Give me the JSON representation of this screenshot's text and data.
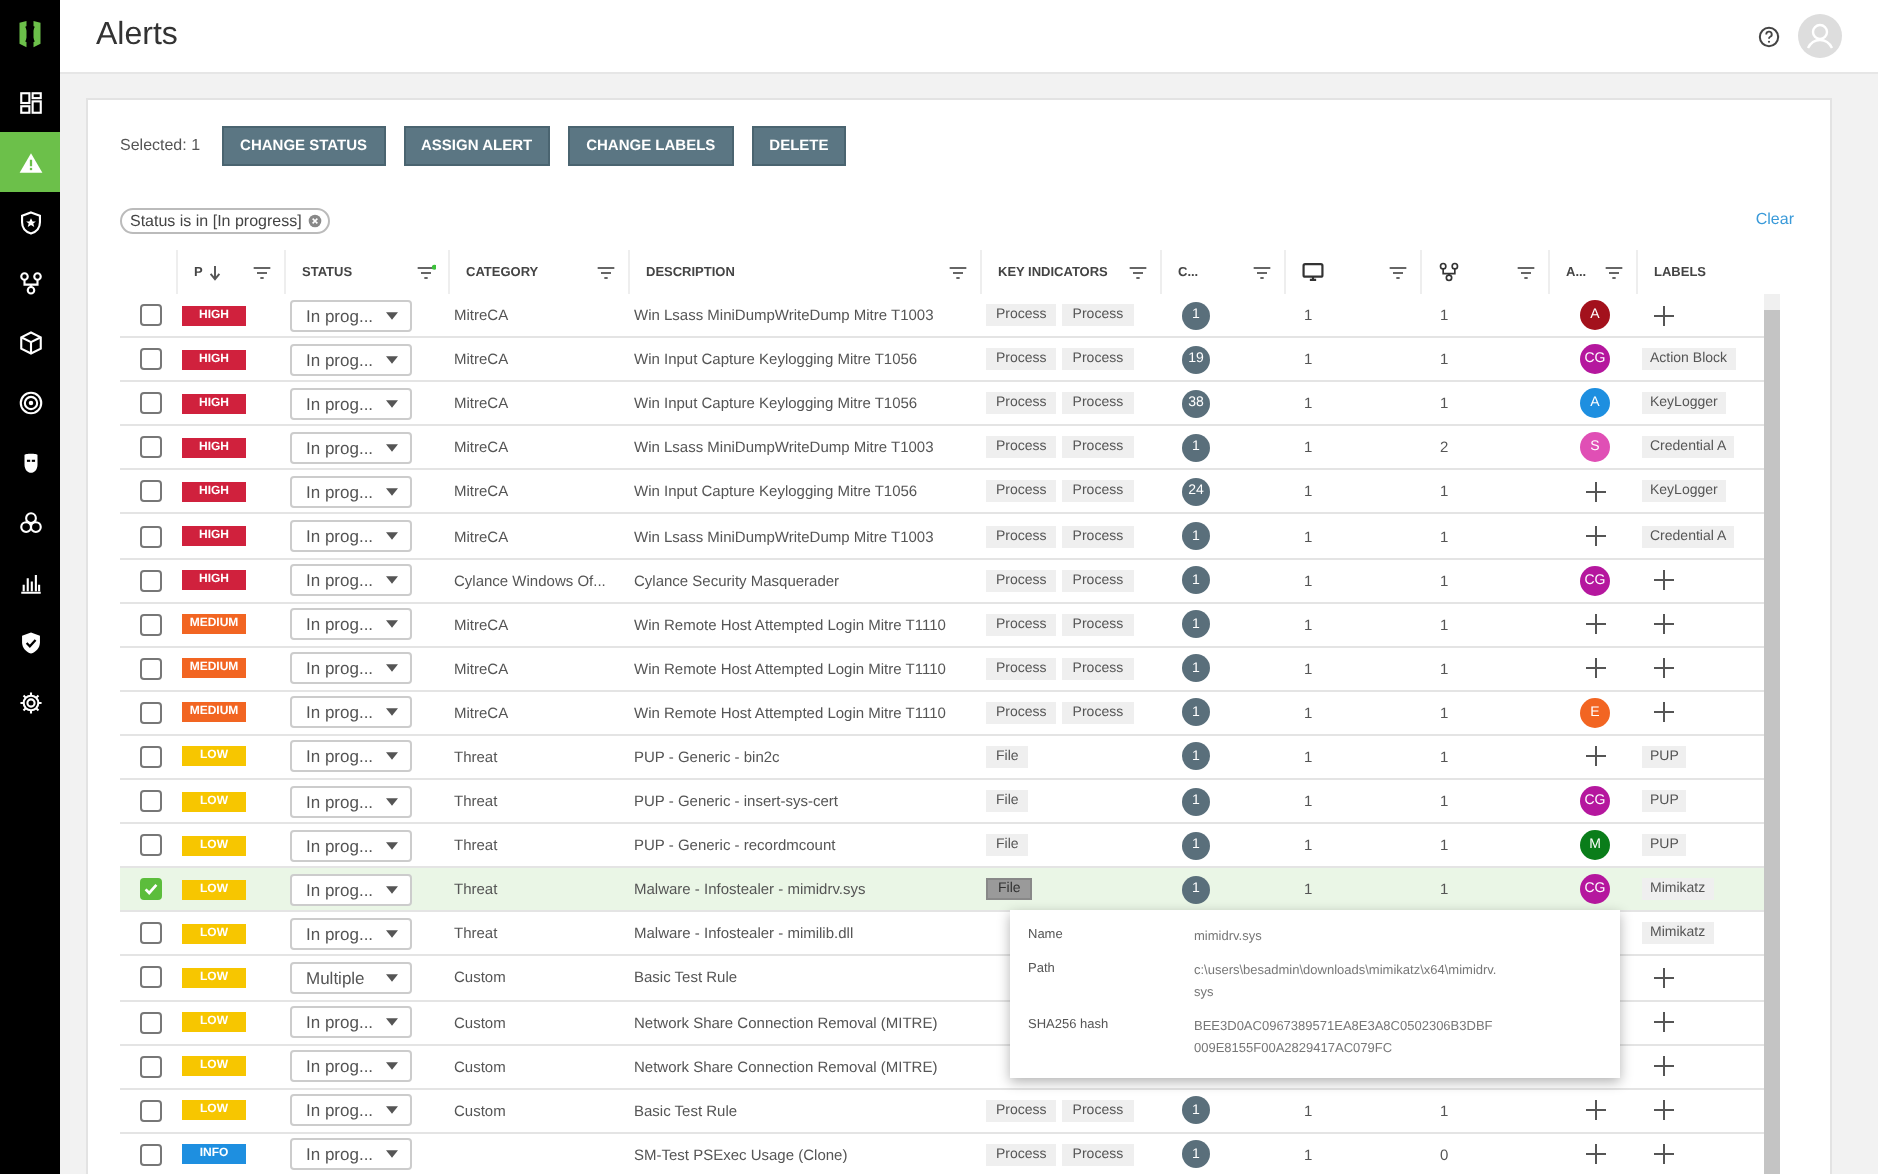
{
  "sidebar": {
    "items": [
      {
        "selected": false
      },
      {
        "selected": true
      },
      {
        "selected": false
      },
      {
        "selected": false
      },
      {
        "selected": false
      },
      {
        "selected": false
      },
      {
        "selected": false
      },
      {
        "selected": false
      },
      {
        "selected": false
      },
      {
        "selected": false
      },
      {
        "selected": false
      }
    ]
  },
  "header": {
    "title": "Alerts"
  },
  "toolbar": {
    "selected_count": "Selected: 1",
    "buttons": [
      "CHANGE STATUS",
      "ASSIGN ALERT",
      "CHANGE LABELS",
      "DELETE"
    ]
  },
  "filters": {
    "chips": [
      "Status is in [In progress]"
    ],
    "clear": "Clear"
  },
  "table": {
    "columns": [
      {
        "kind": "text",
        "label": "P",
        "sorted": true,
        "filter_active": false
      },
      {
        "kind": "text",
        "label": "STATUS",
        "filter_active": true
      },
      {
        "kind": "text",
        "label": "CATEGORY",
        "filter_active": false
      },
      {
        "kind": "text",
        "label": "DESCRIPTION",
        "filter_active": false
      },
      {
        "kind": "text",
        "label": "KEY INDICATORS",
        "filter_active": false
      },
      {
        "kind": "text",
        "label": "C...",
        "filter_active": false
      },
      {
        "kind": "monitor",
        "filter_active": false
      },
      {
        "kind": "network",
        "filter_active": false
      },
      {
        "kind": "text",
        "label": "A...",
        "filter_active": false
      },
      {
        "kind": "text",
        "label": "LABELS"
      }
    ],
    "rows": [
      {
        "checked": false,
        "priority": {
          "text": "HIGH",
          "color": "#d0213d"
        },
        "status": "In prog...",
        "category": "MitreCA",
        "description": "Win Lsass MiniDumpWriteDump Mitre T1003",
        "indicators": [
          {
            "text": "Process",
            "open": false
          },
          {
            "text": "Process",
            "open": false
          }
        ],
        "count": "1",
        "column_7": "1",
        "column_8": "1",
        "assignee": {
          "kind": "avatar",
          "initials": "A",
          "color": "#a3111c"
        },
        "label": {
          "kind": "add"
        }
      },
      {
        "checked": false,
        "priority": {
          "text": "HIGH",
          "color": "#d0213d"
        },
        "status": "In prog...",
        "category": "MitreCA",
        "description": "Win Input Capture Keylogging Mitre T1056",
        "indicators": [
          {
            "text": "Process",
            "open": false
          },
          {
            "text": "Process",
            "open": false
          }
        ],
        "count": "19",
        "column_7": "1",
        "column_8": "1",
        "assignee": {
          "kind": "avatar",
          "initials": "CG",
          "color": "#b5179e"
        },
        "label": {
          "kind": "tag",
          "text": "Action Block"
        }
      },
      {
        "checked": false,
        "priority": {
          "text": "HIGH",
          "color": "#d0213d"
        },
        "status": "In prog...",
        "category": "MitreCA",
        "description": "Win Input Capture Keylogging Mitre T1056",
        "indicators": [
          {
            "text": "Process",
            "open": false
          },
          {
            "text": "Process",
            "open": false
          }
        ],
        "count": "38",
        "column_7": "1",
        "column_8": "1",
        "assignee": {
          "kind": "avatar",
          "initials": "A",
          "color": "#1e8fe0"
        },
        "label": {
          "kind": "tag",
          "text": "KeyLogger"
        }
      },
      {
        "checked": false,
        "priority": {
          "text": "HIGH",
          "color": "#d0213d"
        },
        "status": "In prog...",
        "category": "MitreCA",
        "description": "Win Lsass MiniDumpWriteDump Mitre T1003",
        "indicators": [
          {
            "text": "Process",
            "open": false
          },
          {
            "text": "Process",
            "open": false
          }
        ],
        "count": "1",
        "column_7": "1",
        "column_8": "2",
        "assignee": {
          "kind": "avatar",
          "initials": "S",
          "color": "#e04fb5"
        },
        "label": {
          "kind": "tag",
          "text": "Credential A"
        }
      },
      {
        "checked": false,
        "priority": {
          "text": "HIGH",
          "color": "#d0213d"
        },
        "status": "In prog...",
        "category": "MitreCA",
        "description": "Win Input Capture Keylogging Mitre T1056",
        "indicators": [
          {
            "text": "Process",
            "open": false
          },
          {
            "text": "Process",
            "open": false
          }
        ],
        "count": "24",
        "column_7": "1",
        "column_8": "1",
        "assignee": {
          "kind": "add"
        },
        "label": {
          "kind": "tag",
          "text": "KeyLogger"
        }
      },
      {
        "checked": false,
        "priority": {
          "text": "HIGH",
          "color": "#d0213d"
        },
        "status": "In prog...",
        "category": "MitreCA",
        "description": "Win Lsass MiniDumpWriteDump Mitre T1003",
        "indicators": [
          {
            "text": "Process",
            "open": false
          },
          {
            "text": "Process",
            "open": false
          }
        ],
        "count": "1",
        "column_7": "1",
        "column_8": "1",
        "assignee": {
          "kind": "add"
        },
        "label": {
          "kind": "tag",
          "text": "Credential A"
        }
      },
      {
        "checked": false,
        "priority": {
          "text": "HIGH",
          "color": "#d0213d"
        },
        "status": "In prog...",
        "category": "Cylance Windows Of...",
        "description": "Cylance Security Masquerader",
        "indicators": [
          {
            "text": "Process",
            "open": false
          },
          {
            "text": "Process",
            "open": false
          }
        ],
        "count": "1",
        "column_7": "1",
        "column_8": "1",
        "assignee": {
          "kind": "avatar",
          "initials": "CG",
          "color": "#b5179e"
        },
        "label": {
          "kind": "add"
        }
      },
      {
        "checked": false,
        "priority": {
          "text": "MEDIUM",
          "color": "#f26522"
        },
        "status": "In prog...",
        "category": "MitreCA",
        "description": "Win Remote Host Attempted Login Mitre T1110",
        "indicators": [
          {
            "text": "Process",
            "open": false
          },
          {
            "text": "Process",
            "open": false
          }
        ],
        "count": "1",
        "column_7": "1",
        "column_8": "1",
        "assignee": {
          "kind": "add"
        },
        "label": {
          "kind": "add"
        }
      },
      {
        "checked": false,
        "priority": {
          "text": "MEDIUM",
          "color": "#f26522"
        },
        "status": "In prog...",
        "category": "MitreCA",
        "description": "Win Remote Host Attempted Login Mitre T1110",
        "indicators": [
          {
            "text": "Process",
            "open": false
          },
          {
            "text": "Process",
            "open": false
          }
        ],
        "count": "1",
        "column_7": "1",
        "column_8": "1",
        "assignee": {
          "kind": "add"
        },
        "label": {
          "kind": "add"
        }
      },
      {
        "checked": false,
        "priority": {
          "text": "MEDIUM",
          "color": "#f26522"
        },
        "status": "In prog...",
        "category": "MitreCA",
        "description": "Win Remote Host Attempted Login Mitre T1110",
        "indicators": [
          {
            "text": "Process",
            "open": false
          },
          {
            "text": "Process",
            "open": false
          }
        ],
        "count": "1",
        "column_7": "1",
        "column_8": "1",
        "assignee": {
          "kind": "avatar",
          "initials": "E",
          "color": "#f26522"
        },
        "label": {
          "kind": "add"
        }
      },
      {
        "checked": false,
        "priority": {
          "text": "LOW",
          "color": "#f7c600"
        },
        "status": "In prog...",
        "category": "Threat",
        "description": "PUP - Generic - bin2c",
        "indicators": [
          {
            "text": "File",
            "open": false
          }
        ],
        "count": "1",
        "column_7": "1",
        "column_8": "1",
        "assignee": {
          "kind": "add"
        },
        "label": {
          "kind": "tag",
          "text": "PUP"
        }
      },
      {
        "checked": false,
        "priority": {
          "text": "LOW",
          "color": "#f7c600"
        },
        "status": "In prog...",
        "category": "Threat",
        "description": "PUP - Generic - insert-sys-cert",
        "indicators": [
          {
            "text": "File",
            "open": false
          }
        ],
        "count": "1",
        "column_7": "1",
        "column_8": "1",
        "assignee": {
          "kind": "avatar",
          "initials": "CG",
          "color": "#b5179e"
        },
        "label": {
          "kind": "tag",
          "text": "PUP"
        }
      },
      {
        "checked": false,
        "priority": {
          "text": "LOW",
          "color": "#f7c600"
        },
        "status": "In prog...",
        "category": "Threat",
        "description": "PUP - Generic - recordmcount",
        "indicators": [
          {
            "text": "File",
            "open": false
          }
        ],
        "count": "1",
        "column_7": "1",
        "column_8": "1",
        "assignee": {
          "kind": "avatar",
          "initials": "M",
          "color": "#0a7d1a"
        },
        "label": {
          "kind": "tag",
          "text": "PUP"
        }
      },
      {
        "checked": true,
        "priority": {
          "text": "LOW",
          "color": "#f7c600"
        },
        "status": "In prog...",
        "category": "Threat",
        "description": "Malware - Infostealer - mimidrv.sys",
        "indicators": [
          {
            "text": "File",
            "open": true
          }
        ],
        "count": "1",
        "column_7": "1",
        "column_8": "1",
        "assignee": {
          "kind": "avatar",
          "initials": "CG",
          "color": "#b5179e"
        },
        "label": {
          "kind": "tag",
          "text": "Mimikatz"
        }
      },
      {
        "checked": false,
        "priority": {
          "text": "LOW",
          "color": "#f7c600"
        },
        "status": "In prog...",
        "category": "Threat",
        "description": "Malware - Infostealer - mimilib.dll",
        "label": {
          "kind": "tag",
          "text": "Mimikatz"
        }
      },
      {
        "checked": false,
        "priority": {
          "text": "LOW",
          "color": "#f7c600"
        },
        "status": "Multiple",
        "category": "Custom",
        "description": "Basic Test Rule",
        "label": {
          "kind": "add"
        }
      },
      {
        "checked": false,
        "priority": {
          "text": "LOW",
          "color": "#f7c600"
        },
        "status": "In prog...",
        "category": "Custom",
        "description": "Network Share Connection Removal (MITRE)",
        "label": {
          "kind": "add"
        }
      },
      {
        "checked": false,
        "priority": {
          "text": "LOW",
          "color": "#f7c600"
        },
        "status": "In prog...",
        "category": "Custom",
        "description": "Network Share Connection Removal (MITRE)",
        "label": {
          "kind": "add"
        }
      },
      {
        "checked": false,
        "priority": {
          "text": "LOW",
          "color": "#f7c600"
        },
        "status": "In prog...",
        "category": "Custom",
        "description": "Basic Test Rule",
        "indicators": [
          {
            "text": "Process",
            "open": false
          },
          {
            "text": "Process",
            "open": false
          }
        ],
        "count": "1",
        "column_7": "1",
        "column_8": "1",
        "assignee": {
          "kind": "add"
        },
        "label": {
          "kind": "add"
        }
      },
      {
        "checked": false,
        "priority": {
          "text": "INFO",
          "color": "#1e8fe0"
        },
        "status": "In prog...",
        "description": "SM-Test PSExec Usage (Clone)",
        "indicators": [
          {
            "text": "Process",
            "open": false
          },
          {
            "text": "Process",
            "open": false
          }
        ],
        "count": "1",
        "column_7": "1",
        "column_8": "0",
        "assignee": {
          "kind": "add"
        },
        "label": {
          "kind": "add"
        }
      }
    ]
  },
  "popover": {
    "fields": [
      {
        "label": "Name",
        "value": "mimidrv.sys"
      },
      {
        "label": "Path",
        "value": "c:\\users\\besadmin\\downloads\\mimikatz\\x64\\mimidrv.sys"
      },
      {
        "label": "SHA256 hash",
        "value": "BEE3D0AC0967389571EA8E3A8C0502306B3DBF009E8155F00A2829417AC079FC"
      }
    ]
  }
}
